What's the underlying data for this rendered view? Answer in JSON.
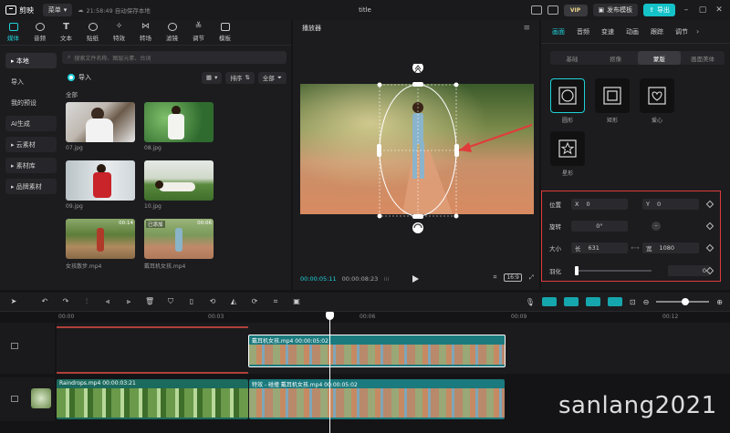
{
  "titlebar": {
    "app_name": "剪映",
    "menu_label": "菜单",
    "autosave": "21:58:49 自动保存本地",
    "title": "title",
    "vip": "VIP",
    "publish": "发布模板",
    "export": "导出"
  },
  "left_tabs": [
    {
      "label": "媒体",
      "icon": "media-icon",
      "active": true
    },
    {
      "label": "音频",
      "icon": "audio-icon"
    },
    {
      "label": "文本",
      "icon": "text-icon"
    },
    {
      "label": "贴纸",
      "icon": "sticker-icon"
    },
    {
      "label": "特效",
      "icon": "effects-icon"
    },
    {
      "label": "转场",
      "icon": "transition-icon"
    },
    {
      "label": "滤镜",
      "icon": "filter-icon"
    },
    {
      "label": "调节",
      "icon": "adjust-icon"
    },
    {
      "label": "模板",
      "icon": "template-icon"
    }
  ],
  "sidenav": [
    {
      "label": "▸ 本地",
      "active": true
    },
    {
      "label": "导入"
    },
    {
      "label": "我的预设"
    },
    {
      "label": "AI生成",
      "boxed": true
    },
    {
      "label": "▸ 云素材",
      "boxed": true
    },
    {
      "label": "▸ 素材库",
      "boxed": true
    },
    {
      "label": "▸ 品牌素材",
      "boxed": true
    }
  ],
  "media": {
    "search_placeholder": "搜索文件名称、图层元素、台词",
    "import_label": "导入",
    "sort_label": "排序",
    "all_filter": "全部",
    "section_label": "全部",
    "items": [
      {
        "name": "07.jpg",
        "added": "",
        "duration": ""
      },
      {
        "name": "08.jpg",
        "added": "",
        "duration": ""
      },
      {
        "name": "09.jpg",
        "added": "",
        "duration": ""
      },
      {
        "name": "10.jpg",
        "added": "",
        "duration": ""
      },
      {
        "name": "女孩散步.mp4",
        "added": "",
        "duration": "00:14"
      },
      {
        "name": "戴耳机女孩.mp4",
        "added": "已添加",
        "duration": "00:06"
      }
    ]
  },
  "player": {
    "title": "播放器",
    "current_time": "00:00:05:11",
    "total_time": "00:00:08:23",
    "ratio": "16:9"
  },
  "right_tabs": [
    {
      "label": "画面",
      "active": true
    },
    {
      "label": "音频"
    },
    {
      "label": "变速"
    },
    {
      "label": "动画"
    },
    {
      "label": "跟踪"
    },
    {
      "label": "调节"
    }
  ],
  "subtabs": [
    {
      "label": "基础"
    },
    {
      "label": "抠像"
    },
    {
      "label": "蒙版",
      "active": true
    },
    {
      "label": "画面美体"
    }
  ],
  "masks": [
    {
      "name": "圆形",
      "icon": "circle-mask-icon",
      "active": true
    },
    {
      "name": "矩形",
      "icon": "rect-mask-icon"
    },
    {
      "name": "爱心",
      "icon": "heart-mask-icon"
    },
    {
      "name": "星形",
      "icon": "star-mask-icon"
    }
  ],
  "props": {
    "position_label": "位置",
    "x_label": "X",
    "x_value": "0",
    "y_label": "Y",
    "y_value": "0",
    "rotate_label": "旋转",
    "rotate_value": "0°",
    "size_label": "大小",
    "w_label": "长",
    "w_value": "631",
    "h_label": "宽",
    "h_value": "1080",
    "feather_label": "羽化",
    "feather_value": "0"
  },
  "timeline": {
    "ruler": [
      "00:00",
      "00:03",
      "00:06",
      "00:09",
      "00:12"
    ],
    "clip_top": "戴耳机女孩.mp4  00:00:05:02",
    "clip_bottom_a": "Raindrops.mp4  00:00:03:21",
    "clip_bottom_b": "特效 - 碰撞  戴耳机女孩.mp4  00:00:05:02"
  },
  "watermark": "sanlang2021",
  "colors": {
    "accent": "#1fd2d8",
    "highlight_box": "#e03b3b",
    "clip_teal": "#1b7a7e"
  }
}
